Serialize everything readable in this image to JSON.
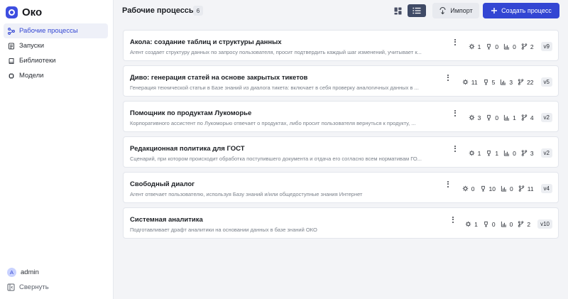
{
  "app": {
    "name": "Око",
    "accent": "#3346d3"
  },
  "sidebar": {
    "items": [
      {
        "label": "Рабочие процессы",
        "icon": "workflow-icon",
        "active": true
      },
      {
        "label": "Запуски",
        "icon": "runs-icon",
        "active": false
      },
      {
        "label": "Библиотеки",
        "icon": "library-icon",
        "active": false
      },
      {
        "label": "Модели",
        "icon": "cpu-icon",
        "active": false
      }
    ],
    "user": {
      "initial": "A",
      "name": "admin"
    },
    "collapse_label": "Свернуть"
  },
  "header": {
    "title": "Рабочие процессы",
    "count": "6",
    "import_label": "Импорт",
    "create_label": "Создать процесс"
  },
  "workflows": [
    {
      "title": "Акола: создание таблиц и структуры данных",
      "desc": "Агент создает структуру данных по запросу пользователя, просит подтвердить каждый шаг изменений, учитывает к...",
      "s1": "1",
      "s2": "0",
      "s3": "0",
      "s4": "2",
      "version": "v9"
    },
    {
      "title": "Диво: генерация статей на основе закрытых тикетов",
      "desc": "Генерация технической статьи в Базе знаний из диалога тикета: включает в себя проверку аналогичных данных в ...",
      "s1": "11",
      "s2": "5",
      "s3": "3",
      "s4": "22",
      "version": "v5"
    },
    {
      "title": "Помощник по продуктам Лукоморье",
      "desc": "Корпоративного ассистент по Лукоморью отвечает о продуктах, либо просит пользователя вернуться к продукту, ...",
      "s1": "3",
      "s2": "0",
      "s3": "1",
      "s4": "4",
      "version": "v2"
    },
    {
      "title": "Редакционная политика для ГОСТ",
      "desc": "Сценарий, при котором происходит обработка поступившего документа и отдача его согласно всем нормативам ГО...",
      "s1": "1",
      "s2": "1",
      "s3": "0",
      "s4": "3",
      "version": "v2"
    },
    {
      "title": "Свободный диалог",
      "desc": "Агент отвечает пользователю, используя Базу знаний и/или общедоступные знания Интернет",
      "s1": "0",
      "s2": "10",
      "s3": "0",
      "s4": "11",
      "version": "v4"
    },
    {
      "title": "Системная аналитика",
      "desc": "Подготавливает драфт аналитики на основании данных в базе знаний ОКО",
      "s1": "1",
      "s2": "0",
      "s3": "0",
      "s4": "2",
      "version": "v10"
    }
  ]
}
